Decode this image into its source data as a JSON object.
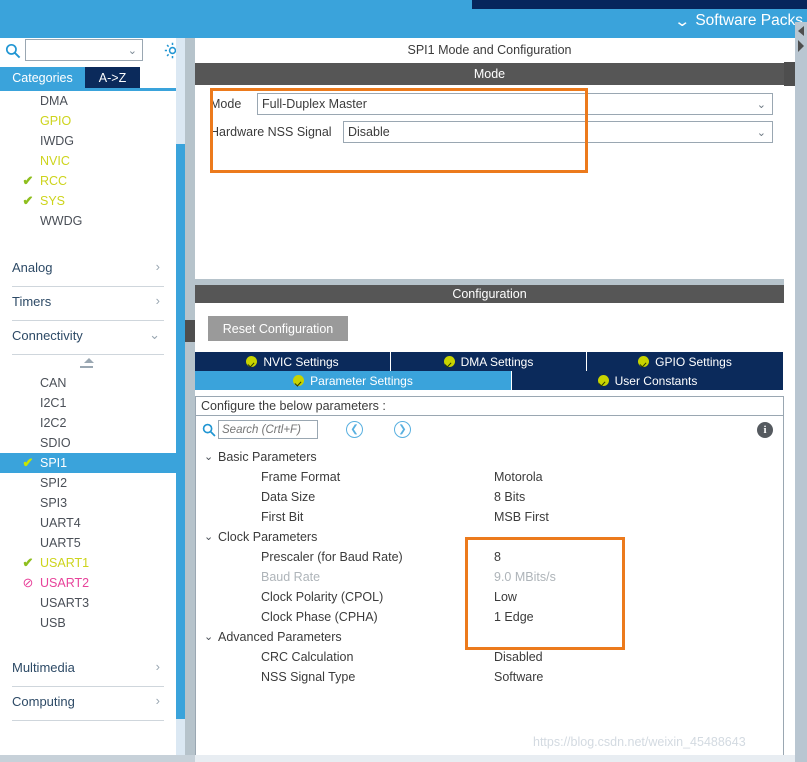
{
  "topbar": {
    "software_packs_label": "Software Packs",
    "chevron_icon": "chevron-down-icon",
    "accent_color": "#3aa3db",
    "navy_color": "#06265c"
  },
  "left_panel": {
    "search_value": "",
    "search_icon": "search-icon",
    "gear_icon": "gear-icon",
    "tabs": [
      {
        "label": "Categories",
        "active": true
      },
      {
        "label": "A->Z",
        "active": false
      }
    ],
    "middleware_items": [
      {
        "label": "DMA",
        "state": "normal",
        "mark": ""
      },
      {
        "label": "GPIO",
        "state": "yellow",
        "mark": ""
      },
      {
        "label": "IWDG",
        "state": "normal",
        "mark": ""
      },
      {
        "label": "NVIC",
        "state": "yellow",
        "mark": ""
      },
      {
        "label": "RCC",
        "state": "yellow",
        "mark": "✔"
      },
      {
        "label": "SYS",
        "state": "yellow",
        "mark": "✔"
      },
      {
        "label": "WWDG",
        "state": "normal",
        "mark": ""
      }
    ],
    "groups": [
      {
        "label": "Analog",
        "arrow": "›"
      },
      {
        "label": "Timers",
        "arrow": "›"
      },
      {
        "label": "Connectivity",
        "arrow": "⌄"
      }
    ],
    "connectivity_items": [
      {
        "label": "CAN",
        "state": "normal",
        "mark": ""
      },
      {
        "label": "I2C1",
        "state": "normal",
        "mark": ""
      },
      {
        "label": "I2C2",
        "state": "normal",
        "mark": ""
      },
      {
        "label": "SDIO",
        "state": "normal",
        "mark": ""
      },
      {
        "label": "SPI1",
        "state": "selected",
        "mark": "✔"
      },
      {
        "label": "SPI2",
        "state": "normal",
        "mark": ""
      },
      {
        "label": "SPI3",
        "state": "normal",
        "mark": ""
      },
      {
        "label": "UART4",
        "state": "normal",
        "mark": ""
      },
      {
        "label": "UART5",
        "state": "normal",
        "mark": ""
      },
      {
        "label": "USART1",
        "state": "yellow",
        "mark": "✔"
      },
      {
        "label": "USART2",
        "state": "pink",
        "mark": "⊘"
      },
      {
        "label": "USART3",
        "state": "normal",
        "mark": ""
      },
      {
        "label": "USB",
        "state": "normal",
        "mark": ""
      }
    ],
    "bottom_groups": [
      {
        "label": "Multimedia",
        "arrow": "›"
      },
      {
        "label": "Computing",
        "arrow": "›"
      }
    ]
  },
  "right_panel": {
    "header_title": "SPI1 Mode and Configuration",
    "mode_section_title": "Mode",
    "config_section_title": "Configuration",
    "mode_fields": [
      {
        "label": "Mode",
        "value": "Full-Duplex Master",
        "dropdown_icon": "chevron-down-icon"
      },
      {
        "label": "Hardware NSS Signal",
        "value": "Disable",
        "dropdown_icon": "chevron-down-icon"
      }
    ],
    "reset_button_label": "Reset Configuration",
    "tabs_row1": [
      {
        "label": "NVIC Settings",
        "active": false,
        "icon": "check-circle-icon"
      },
      {
        "label": "DMA Settings",
        "active": false,
        "icon": "check-circle-icon"
      },
      {
        "label": "GPIO Settings",
        "active": false,
        "icon": "check-circle-icon"
      }
    ],
    "tabs_row2": [
      {
        "label": "Parameter Settings",
        "active": true,
        "icon": "check-circle-icon"
      },
      {
        "label": "User Constants",
        "active": false,
        "icon": "check-circle-icon"
      }
    ],
    "configure_hint": "Configure the below parameters :",
    "search_placeholder": "Search (Crtl+F)",
    "search_value": "",
    "search_icon": "search-icon",
    "nav_back_icon": "chevron-left-circle-icon",
    "nav_forward_icon": "chevron-right-circle-icon",
    "info_icon": "info-icon",
    "parameter_groups": [
      {
        "name": "Basic Parameters",
        "expanded": true,
        "rows": [
          {
            "name": "Frame Format",
            "value": "Motorola",
            "dim": false
          },
          {
            "name": "Data Size",
            "value": "8 Bits",
            "dim": false
          },
          {
            "name": "First Bit",
            "value": "MSB First",
            "dim": false
          }
        ]
      },
      {
        "name": "Clock Parameters",
        "expanded": true,
        "rows": [
          {
            "name": "Prescaler (for Baud Rate)",
            "value": "8",
            "dim": false
          },
          {
            "name": "Baud Rate",
            "value": "9.0 MBits/s",
            "dim": true
          },
          {
            "name": "Clock Polarity (CPOL)",
            "value": "Low",
            "dim": false
          },
          {
            "name": "Clock Phase (CPHA)",
            "value": "1 Edge",
            "dim": false
          }
        ]
      },
      {
        "name": "Advanced Parameters",
        "expanded": true,
        "rows": [
          {
            "name": "CRC Calculation",
            "value": "Disabled",
            "dim": false
          },
          {
            "name": "NSS Signal Type",
            "value": "Software",
            "dim": false
          }
        ]
      }
    ],
    "highlight_color": "#ec7a1c"
  },
  "watermark": "https://blog.csdn.net/weixin_45488643"
}
